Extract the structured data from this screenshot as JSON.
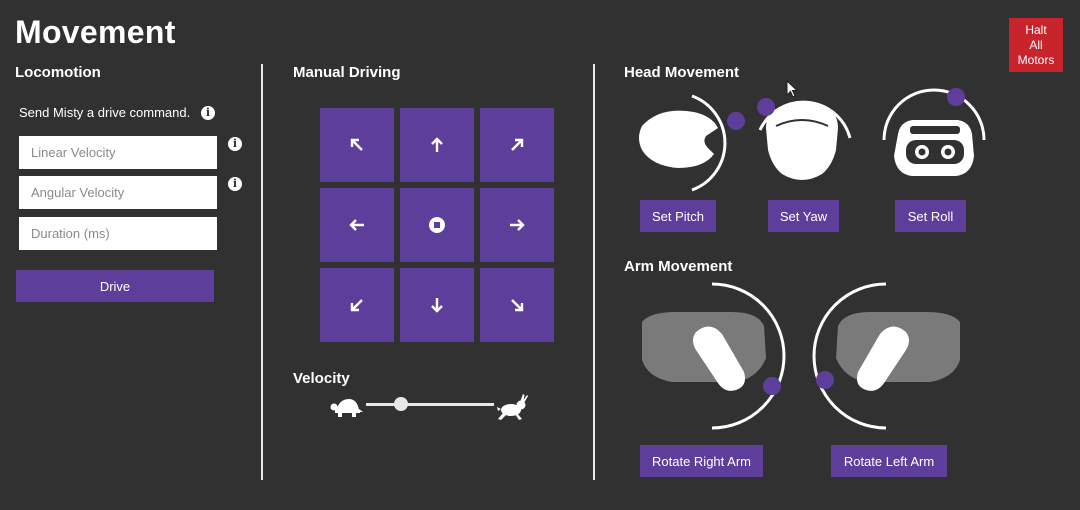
{
  "page": {
    "title": "Movement"
  },
  "halt": {
    "label": "Halt\nAll\nMotors"
  },
  "locomotion": {
    "title": "Locomotion",
    "info_text": "Send Misty a drive command.",
    "linear_placeholder": "Linear Velocity",
    "angular_placeholder": "Angular Velocity",
    "duration_placeholder": "Duration (ms)",
    "drive_label": "Drive"
  },
  "manual_driving": {
    "title": "Manual Driving"
  },
  "velocity": {
    "title": "Velocity",
    "level": 0.27
  },
  "head": {
    "title": "Head Movement",
    "pitch_label": "Set Pitch",
    "yaw_label": "Set Yaw",
    "roll_label": "Set Roll"
  },
  "arm": {
    "title": "Arm Movement",
    "right_label": "Rotate Right Arm",
    "left_label": "Rotate Left Arm"
  },
  "colors": {
    "accent": "#5d3f9b",
    "halt": "#c8242b",
    "background": "#323131"
  },
  "icons": [
    "info-icon",
    "arrow-up-left-icon",
    "arrow-up-icon",
    "arrow-up-right-icon",
    "arrow-left-icon",
    "stop-icon",
    "arrow-right-icon",
    "arrow-down-left-icon",
    "arrow-down-icon",
    "arrow-down-right-icon",
    "turtle-icon",
    "rabbit-icon",
    "cursor-icon"
  ]
}
